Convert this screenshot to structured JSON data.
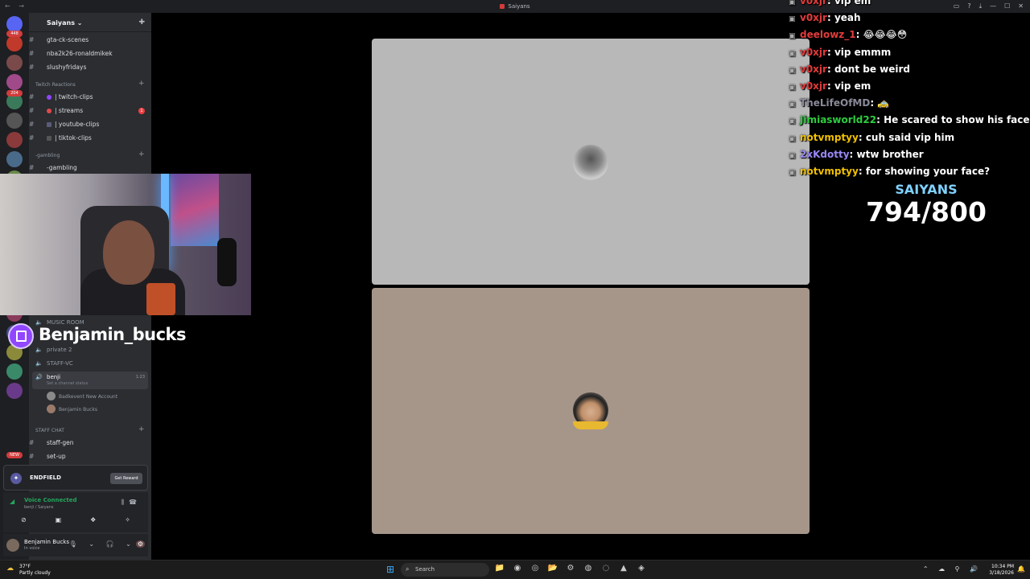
{
  "window": {
    "title": "Saiyans",
    "nav_glyphs": "← →",
    "toolbar_icons": [
      "inbox-icon",
      "help-icon",
      "download-icon",
      "minimize-icon",
      "maximize-icon",
      "close-icon"
    ],
    "toolbar_glyphs": [
      "▭",
      "?",
      "⤓",
      "—",
      "☐",
      "✕"
    ]
  },
  "rail": {
    "badges": [
      "448",
      "204",
      "NEW"
    ],
    "colors": [
      "#5865f2",
      "#c0392b",
      "#7a4a4a",
      "#a04a8a",
      "#3a7a5a",
      "#555555",
      "#8a3a3a",
      "#4a6a8a",
      "#6a8a4a",
      "#8a6a4a",
      "#4a8a8a",
      "#a0522d",
      "#8a4a8a",
      "#3a5a8a",
      "#5a8a3a",
      "#8a3a5a",
      "#4a4a8a",
      "#8a8a3a",
      "#3a8a6a",
      "#6a3a8a"
    ]
  },
  "sidebar": {
    "server_name": "Saiyans",
    "server_chevron": "⌄",
    "add_member_icon": "✚",
    "channels_top": [
      {
        "label": "gta-ck-scenes"
      },
      {
        "label": "nba2k26-ronaldmikek"
      },
      {
        "label": "slushyfridays"
      }
    ],
    "category_twitch": "Twitch Reactions",
    "channels_twitch": [
      {
        "label": "| twitch-clips",
        "dot": "#9146ff"
      },
      {
        "label": "| streams",
        "dot": "#e04a4a",
        "ping": "1"
      },
      {
        "label": "| youtube-clips",
        "dot": "#5a5a7a"
      },
      {
        "label": "| tiktok-clips",
        "dot": "#3a3a3a"
      }
    ],
    "category_gambling": "-gambling",
    "channel_gambling": "-gambling",
    "voice_music": "MUSIC ROOM",
    "voice_private": "private 2",
    "voice_staff": "STAFF-VC",
    "benji_channel": {
      "name": "benji",
      "status": "Set a channel status",
      "time": "1:23"
    },
    "voice_users": [
      {
        "name": "Badkevent New Account"
      },
      {
        "name": "Benjamin Bucks"
      }
    ],
    "category_staff": "STAFF CHAT",
    "channels_staff": [
      {
        "label": "staff-gen"
      },
      {
        "label": "set-up"
      }
    ]
  },
  "promo": {
    "title": "ENDFIELD",
    "button": "Get Reward"
  },
  "voice_panel": {
    "status": "Voice Connected",
    "location": "benji / Saiyans",
    "button_glyphs": [
      "⊘",
      "▣",
      "❖",
      "✧"
    ]
  },
  "user_panel": {
    "name": "Benjamin Bucks",
    "status": "In voice",
    "controls": "🎙 ⌄ 🎧 ⌄",
    "gear": "⚙"
  },
  "stream_overlay": {
    "twitch_name": "Benjamin_bucks"
  },
  "chat": [
    {
      "user": "v0xjr",
      "color": "#e33b3b",
      "text": "vip em"
    },
    {
      "user": "v0xjr",
      "color": "#e33b3b",
      "text": "yeah"
    },
    {
      "user": "deelowz_1",
      "color": "#e33b3b",
      "text": "😂😂😂😳"
    },
    {
      "user": "v0xjr",
      "color": "#e33b3b",
      "text": "vip emmm"
    },
    {
      "user": "v0xjr",
      "color": "#e33b3b",
      "text": "dont be weird"
    },
    {
      "user": "v0xjr",
      "color": "#e33b3b",
      "text": "vip em"
    },
    {
      "user": "TheLifeOfMD",
      "color": "#8a8a9a",
      "text": "🚕"
    },
    {
      "user": "Jimiasworld22",
      "color": "#2ecc40",
      "text": "He scared to show his face?"
    },
    {
      "user": "notvmptyy",
      "color": "#f0c000",
      "text": "cuh said vip him"
    },
    {
      "user": "2xKdotty",
      "color": "#9b87f5",
      "text": "wtw brother"
    },
    {
      "user": "notvmptyy",
      "color": "#f0c000",
      "text": "for showing your face?"
    }
  ],
  "goal": {
    "label": "SAIYANS",
    "count": "794/800"
  },
  "taskbar": {
    "weather_temp": "37°F",
    "weather_desc": "Partly cloudy",
    "search_placeholder": "Search",
    "time": "10:34 PM",
    "date": "3/18/2026",
    "tray_glyphs": "⌃ ☁ ⚲ 🔊",
    "apps": [
      "📁",
      "◉",
      "◎",
      "📂",
      "⚙",
      "◍",
      "◌",
      "▲",
      "◈"
    ],
    "bell": "🔔"
  }
}
